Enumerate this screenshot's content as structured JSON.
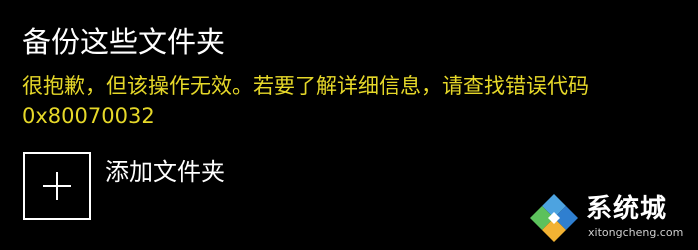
{
  "page": {
    "title": "备份这些文件夹",
    "error_message": "很抱歉，但该操作无效。若要了解详细信息，请查找错误代码",
    "error_code": "0x80070032"
  },
  "add_folder": {
    "icon": "plus-icon",
    "label": "添加文件夹"
  },
  "watermark": {
    "brand": "系统城",
    "url": "xitongcheng.com",
    "colors": {
      "top": "#4da3e0",
      "left": "#5cc15c",
      "right": "#2f7fd0",
      "bottom": "#f2b233"
    }
  },
  "colors": {
    "background": "#000000",
    "title": "#ffffff",
    "error_text": "#e6d829"
  }
}
